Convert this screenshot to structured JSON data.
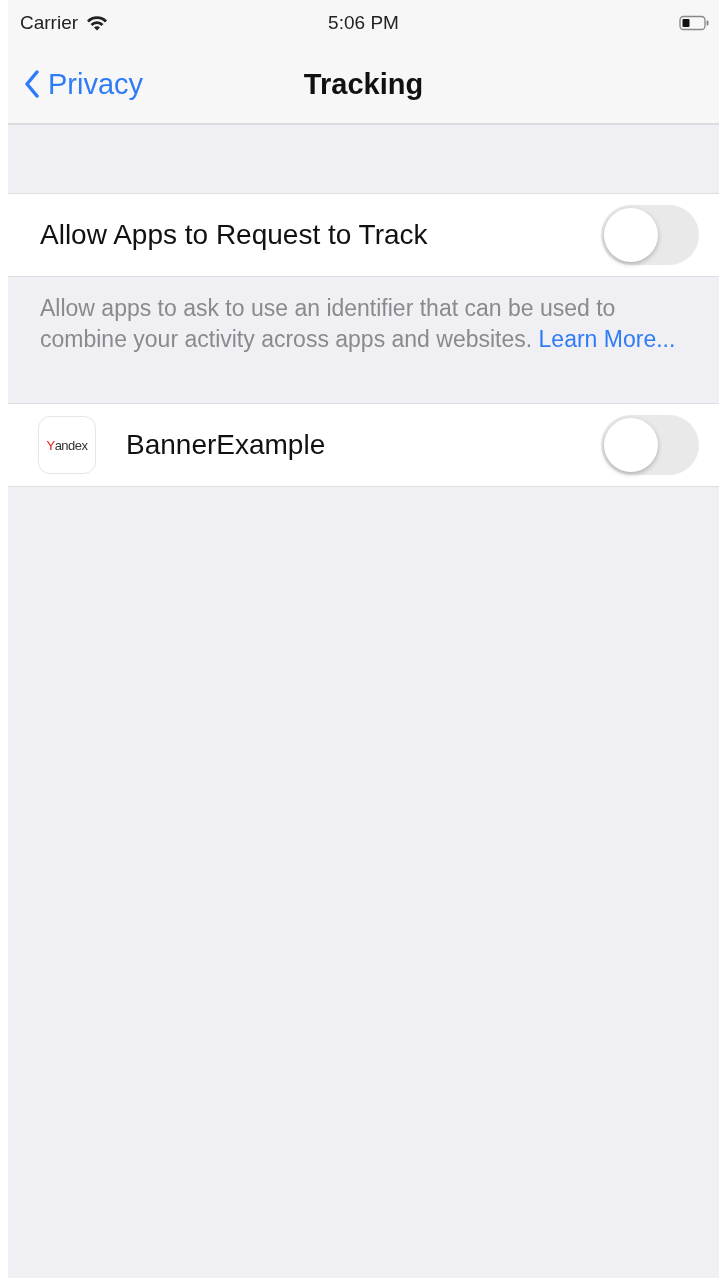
{
  "status_bar": {
    "carrier": "Carrier",
    "time": "5:06 PM"
  },
  "nav_bar": {
    "back_label": "Privacy",
    "title": "Tracking"
  },
  "settings": [
    {
      "label": "Allow Apps to Request to Track",
      "on": false
    }
  ],
  "footer": {
    "text": "Allow apps to ask to use an identifier that can be used to combine your activity across apps and websites.",
    "link": "Learn More..."
  },
  "apps": [
    {
      "icon_text": "Yandex",
      "name": "BannerExample",
      "on": false
    }
  ]
}
